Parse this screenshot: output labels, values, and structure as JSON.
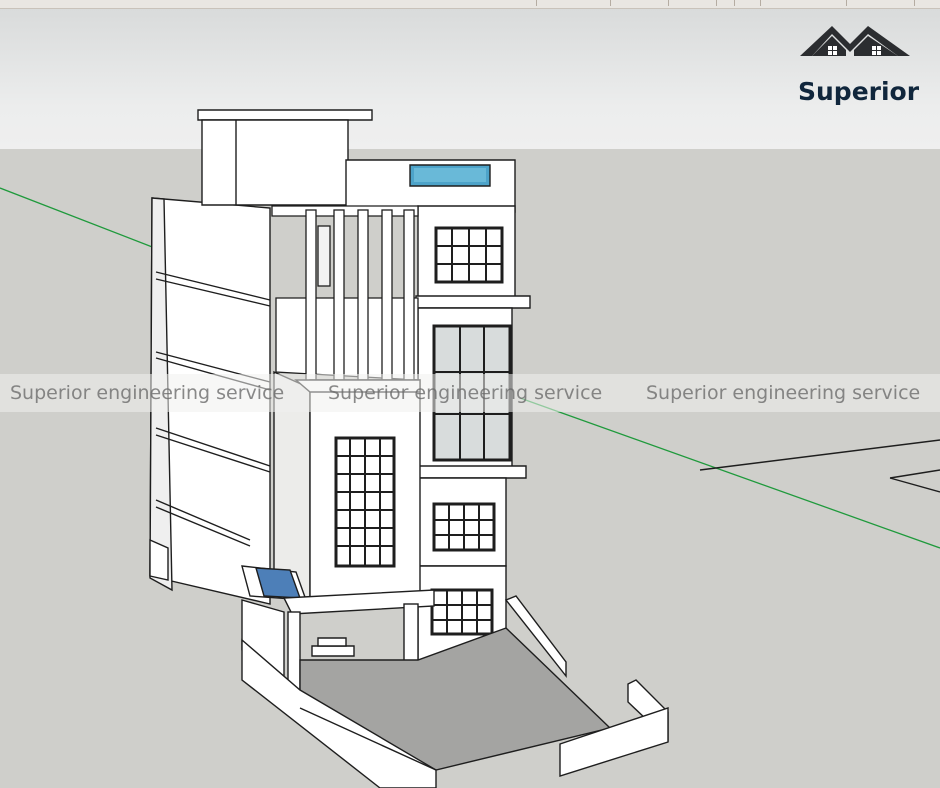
{
  "logo": {
    "brand_name": "Superior",
    "colors": {
      "text": "#10263c",
      "roof": "#2b2d30"
    },
    "icon": "house-roof-icon"
  },
  "watermark": {
    "text": "Superior engineering service",
    "repeat_count": 3
  },
  "scene": {
    "colors": {
      "wall": "#ffffff",
      "wall_shade": "#f2f2f0",
      "ground": "#cfcfcb",
      "edge": "#1e1e1e",
      "glass": "#5aa7c8",
      "axis_green": "#1f9a3c",
      "courtyard": "#9b9b99"
    }
  }
}
